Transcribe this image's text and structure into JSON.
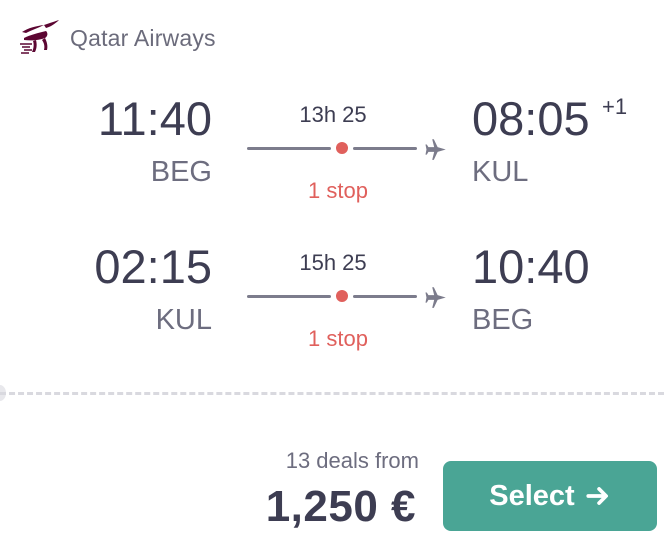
{
  "airline": {
    "name": "Qatar Airways",
    "logo_icon": "qatar-oryx-logo-icon",
    "logo_color": "#5c0632"
  },
  "legs": [
    {
      "departure_time": "11:40",
      "departure_code": "BEG",
      "arrival_time": "08:05",
      "arrival_day_offset": "+1",
      "arrival_code": "KUL",
      "duration": "13h 25",
      "stops": "1 stop"
    },
    {
      "departure_time": "02:15",
      "departure_code": "KUL",
      "arrival_time": "10:40",
      "arrival_day_offset": "",
      "arrival_code": "BEG",
      "duration": "15h 25",
      "stops": "1 stop"
    }
  ],
  "offer": {
    "deals_text": "13 deals from",
    "price": "1,250 €",
    "select_label": "Select",
    "select_icon": "arrow-right-icon"
  },
  "colors": {
    "accent": "#4aa595",
    "stop": "#e0605c",
    "text_dark": "#3d3d52",
    "text_muted": "#6d6d7f"
  }
}
